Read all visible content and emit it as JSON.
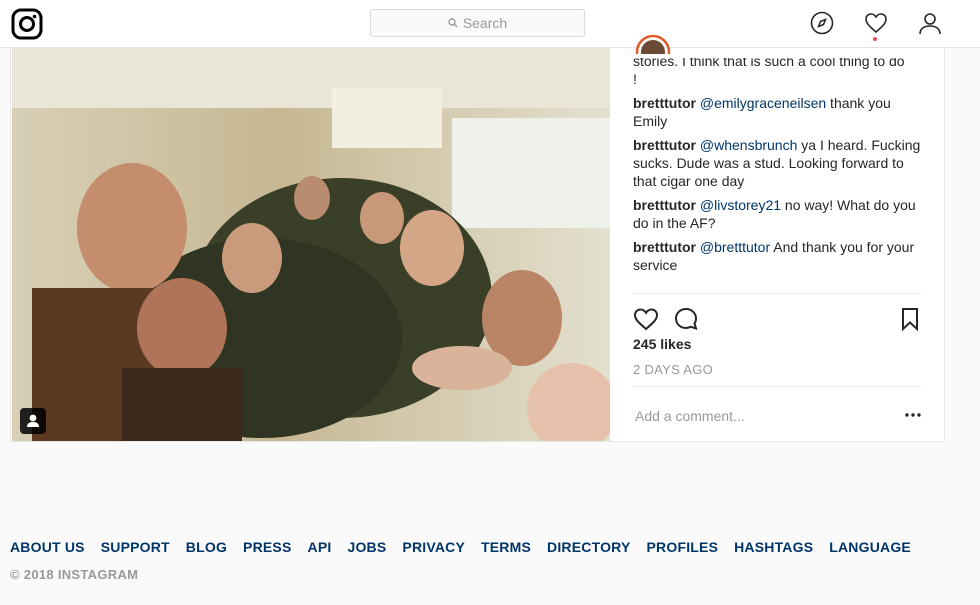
{
  "search": {
    "placeholder": "Search"
  },
  "post": {
    "partial_caption": "stories. I think that is such a cool thing to do",
    "partial_caption_end": "!",
    "comments": [
      {
        "user": "bretttutor",
        "mention": "@emilygraceneilsen",
        "text": " thank you Emily"
      },
      {
        "user": "bretttutor",
        "mention": "@whensbrunch",
        "text": " ya I heard. Fucking sucks. Dude was a stud. Looking forward to that cigar one day"
      },
      {
        "user": "bretttutor",
        "mention": "@livstorey21",
        "text": " no way! What do you do in the AF?"
      },
      {
        "user": "bretttutor",
        "mention": "@bretttutor",
        "text": " And thank you for your service"
      }
    ],
    "likes": "245 likes",
    "time_ago": "2 DAYS AGO",
    "add_comment_placeholder": "Add a comment..."
  },
  "footer": {
    "links": [
      "ABOUT US",
      "SUPPORT",
      "BLOG",
      "PRESS",
      "API",
      "JOBS",
      "PRIVACY",
      "TERMS",
      "DIRECTORY",
      "PROFILES",
      "HASHTAGS",
      "LANGUAGE"
    ],
    "copyright": "© 2018 INSTAGRAM"
  },
  "icons": {
    "logo": "instagram-logo",
    "explore": "compass-icon",
    "activity": "heart-icon",
    "profile": "person-icon",
    "like": "heart-outline-icon",
    "comment": "comment-bubble-icon",
    "save": "bookmark-icon",
    "more": "ellipsis-icon",
    "tagged": "person-tag-icon"
  },
  "colors": {
    "link": "#003569",
    "notification": "#ed4956",
    "muted": "#999999"
  }
}
